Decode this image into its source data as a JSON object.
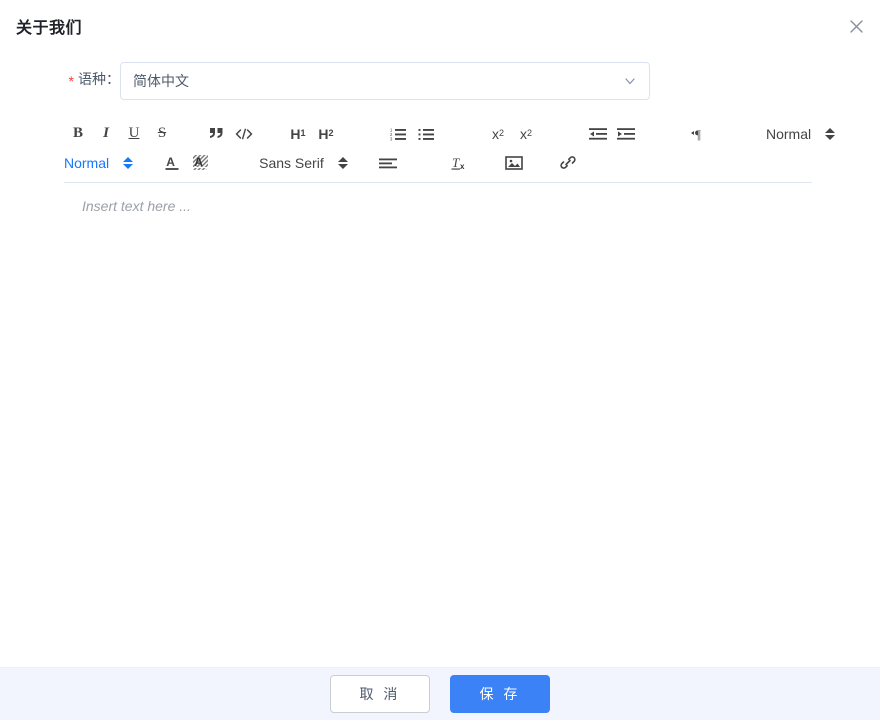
{
  "dialog": {
    "title": "关于我们",
    "close_icon": "close-icon"
  },
  "form": {
    "language_field": {
      "required_marker": "*",
      "label": "语种：",
      "value": "简体中文",
      "arrow_icon": "chevron-down-icon"
    }
  },
  "editor": {
    "placeholder": "Insert text here ...",
    "toolbar": {
      "row1": [
        {
          "name": "bold-icon",
          "glyph": "B"
        },
        {
          "name": "italic-icon",
          "glyph": "I"
        },
        {
          "name": "underline-icon",
          "glyph": "U"
        },
        {
          "name": "strike-icon",
          "glyph": "S"
        },
        {
          "name": "blockquote-icon",
          "glyph": "”"
        },
        {
          "name": "code-block-icon",
          "glyph": "</>"
        },
        {
          "name": "header-1-icon",
          "glyph": "H",
          "sub": "1"
        },
        {
          "name": "header-2-icon",
          "glyph": "H",
          "sub": "2"
        },
        {
          "name": "ordered-list-icon",
          "glyph": ""
        },
        {
          "name": "bullet-list-icon",
          "glyph": ""
        },
        {
          "name": "subscript-icon",
          "glyph": "x",
          "sub": "2"
        },
        {
          "name": "superscript-icon",
          "glyph": "x",
          "sup": "2"
        },
        {
          "name": "outdent-icon",
          "glyph": ""
        },
        {
          "name": "indent-icon",
          "glyph": ""
        },
        {
          "name": "text-direction-icon",
          "glyph": "¶"
        }
      ],
      "size_picker": {
        "label": "Normal",
        "name": "font-size-picker",
        "active": false
      },
      "header_picker": {
        "label": "Normal",
        "name": "header-style-picker",
        "active": true
      },
      "font_picker": {
        "label": "Sans Serif",
        "name": "font-family-picker",
        "active": false
      },
      "row2": [
        {
          "name": "text-color-icon",
          "glyph": "A"
        },
        {
          "name": "background-color-icon",
          "glyph": "A"
        },
        {
          "name": "align-icon",
          "glyph": ""
        },
        {
          "name": "clear-format-icon",
          "glyph": "Tx"
        },
        {
          "name": "image-icon",
          "glyph": ""
        },
        {
          "name": "link-icon",
          "glyph": ""
        }
      ]
    }
  },
  "footer": {
    "cancel_label": "取 消",
    "save_label": "保 存"
  },
  "colors": {
    "accent": "#3b82f6",
    "active_toolbar": "#1677ff",
    "required": "#f53f3f",
    "footer_bg": "#f2f5fd"
  }
}
